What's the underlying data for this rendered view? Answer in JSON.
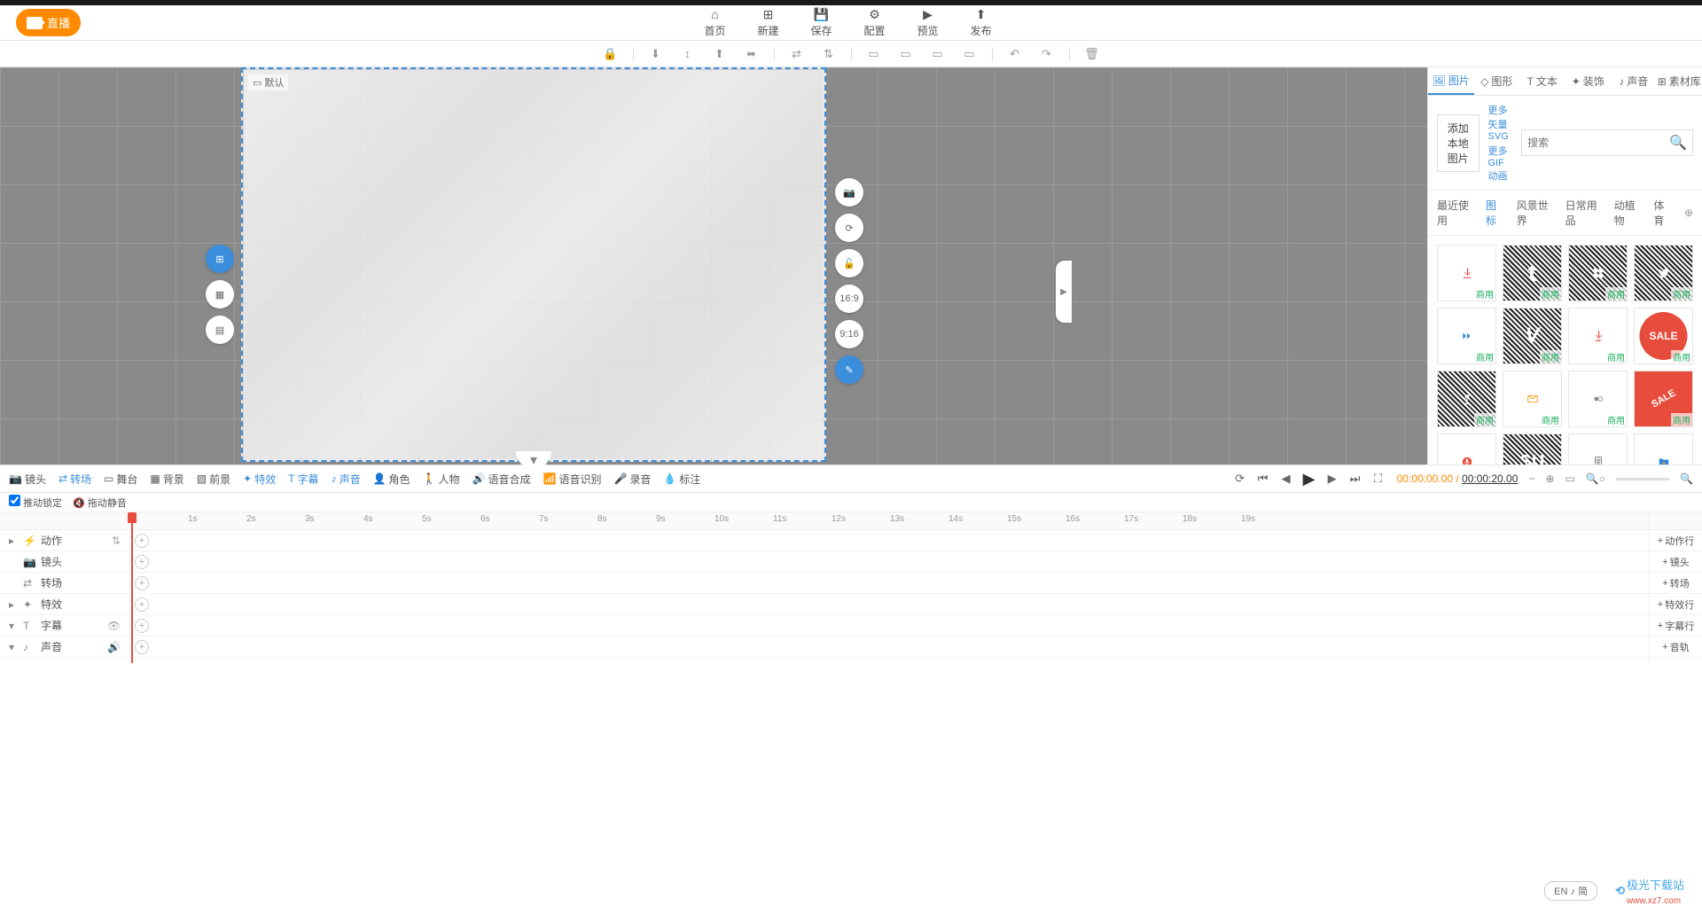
{
  "header": {
    "live_label": "直播",
    "nav": [
      {
        "label": "首页"
      },
      {
        "label": "新建"
      },
      {
        "label": "保存"
      },
      {
        "label": "配置"
      },
      {
        "label": "预览"
      },
      {
        "label": "发布"
      }
    ]
  },
  "canvas": {
    "default_label": "默认"
  },
  "right_tools": {
    "aspect_169": "16:9",
    "aspect_916": "9:16"
  },
  "panel": {
    "tabs": [
      {
        "label": "图片"
      },
      {
        "label": "图形"
      },
      {
        "label": "文本"
      },
      {
        "label": "装饰"
      },
      {
        "label": "声音"
      },
      {
        "label": "素材库"
      }
    ],
    "add_local": "添加本地图片",
    "more_svg": "更多矢量SVG",
    "more_gif": "更多GIF动画",
    "search_placeholder": "搜索",
    "cats": [
      {
        "label": "最近使用"
      },
      {
        "label": "图标"
      },
      {
        "label": "风景世界"
      },
      {
        "label": "日常用品"
      },
      {
        "label": "动植物"
      },
      {
        "label": "体育"
      }
    ],
    "tag": "商用",
    "sale": "SALE"
  },
  "bottom_tools": [
    {
      "label": "镜头"
    },
    {
      "label": "转场"
    },
    {
      "label": "舞台"
    },
    {
      "label": "背景"
    },
    {
      "label": "前景"
    },
    {
      "label": "特效"
    },
    {
      "label": "字幕"
    },
    {
      "label": "声音"
    },
    {
      "label": "角色"
    },
    {
      "label": "人物"
    },
    {
      "label": "语音合成"
    },
    {
      "label": "语音识别"
    },
    {
      "label": "录音"
    },
    {
      "label": "标注"
    }
  ],
  "time": {
    "current": "00:00:00.00",
    "total": "00:00:20.00",
    "sep": " / "
  },
  "opts": {
    "lock": "推动锁定",
    "mute": "拖动静音"
  },
  "ruler_ticks": [
    "1s",
    "2s",
    "3s",
    "4s",
    "5s",
    "6s",
    "7s",
    "8s",
    "9s",
    "10s",
    "11s",
    "12s",
    "13s",
    "14s",
    "15s",
    "16s",
    "17s",
    "18s",
    "19s"
  ],
  "tracks": [
    {
      "label": "动作"
    },
    {
      "label": "镜头"
    },
    {
      "label": "转场"
    },
    {
      "label": "特效"
    },
    {
      "label": "字幕"
    },
    {
      "label": "声音"
    }
  ],
  "track_add": [
    {
      "label": "动作行"
    },
    {
      "label": "镜头"
    },
    {
      "label": "转场"
    },
    {
      "label": "特效行"
    },
    {
      "label": "字幕行"
    },
    {
      "label": "音轨"
    }
  ],
  "footer": {
    "lang": "EN ♪ 简",
    "brand": "极光下载站",
    "url": "www.xz7.com"
  }
}
